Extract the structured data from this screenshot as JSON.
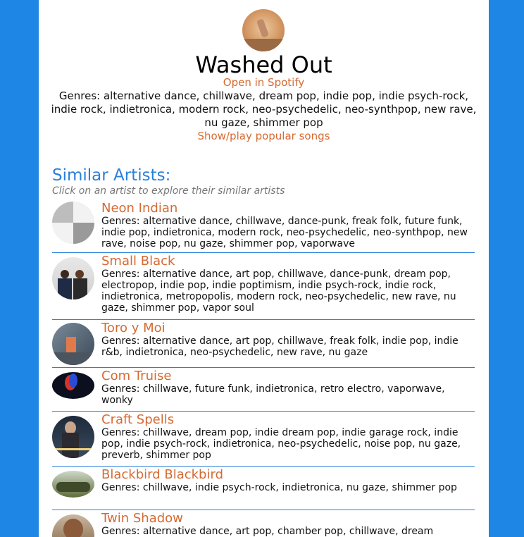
{
  "artist": {
    "name": "Washed Out",
    "spotify_link": "Open in Spotify",
    "genres": "Genres: alternative dance, chillwave, dream pop, indie pop, indie psych-rock, indie rock, indietronica, modern rock, neo-psychedelic, neo-synthpop, new rave, nu gaze, shimmer pop",
    "popular_link": "Show/play popular songs"
  },
  "similar": {
    "title": "Similar Artists:",
    "subtitle": "Click on an artist to explore their similar artists",
    "items": [
      {
        "name": "Neon Indian",
        "genres": "Genres: alternative dance, chillwave, dance-punk, freak folk, future funk, indie pop, indietronica, modern rock, neo-psychedelic, neo-synthpop, new rave, noise pop, nu gaze, shimmer pop, vaporwave"
      },
      {
        "name": "Small Black",
        "genres": "Genres: alternative dance, art pop, chillwave, dance-punk, dream pop, electropop, indie pop, indie poptimism, indie psych-rock, indie rock, indietronica, metropopolis, modern rock, neo-psychedelic, new rave, nu gaze, shimmer pop, vapor soul"
      },
      {
        "name": "Toro y Moi",
        "genres": "Genres: alternative dance, art pop, chillwave, freak folk, indie pop, indie r&b, indietronica, neo-psychedelic, new rave, nu gaze"
      },
      {
        "name": "Com Truise",
        "genres": "Genres: chillwave, future funk, indietronica, retro electro, vaporwave, wonky"
      },
      {
        "name": "Craft Spells",
        "genres": "Genres: chillwave, dream pop, indie dream pop, indie garage rock, indie pop, indie psych-rock, indietronica, neo-psychedelic, noise pop, nu gaze, preverb, shimmer pop"
      },
      {
        "name": "Blackbird Blackbird",
        "genres": "Genres: chillwave, indie psych-rock, indietronica, nu gaze, shimmer pop"
      },
      {
        "name": "Twin Shadow",
        "genres": "Genres: alternative dance, art pop, chamber pop, chillwave, dream"
      }
    ]
  }
}
